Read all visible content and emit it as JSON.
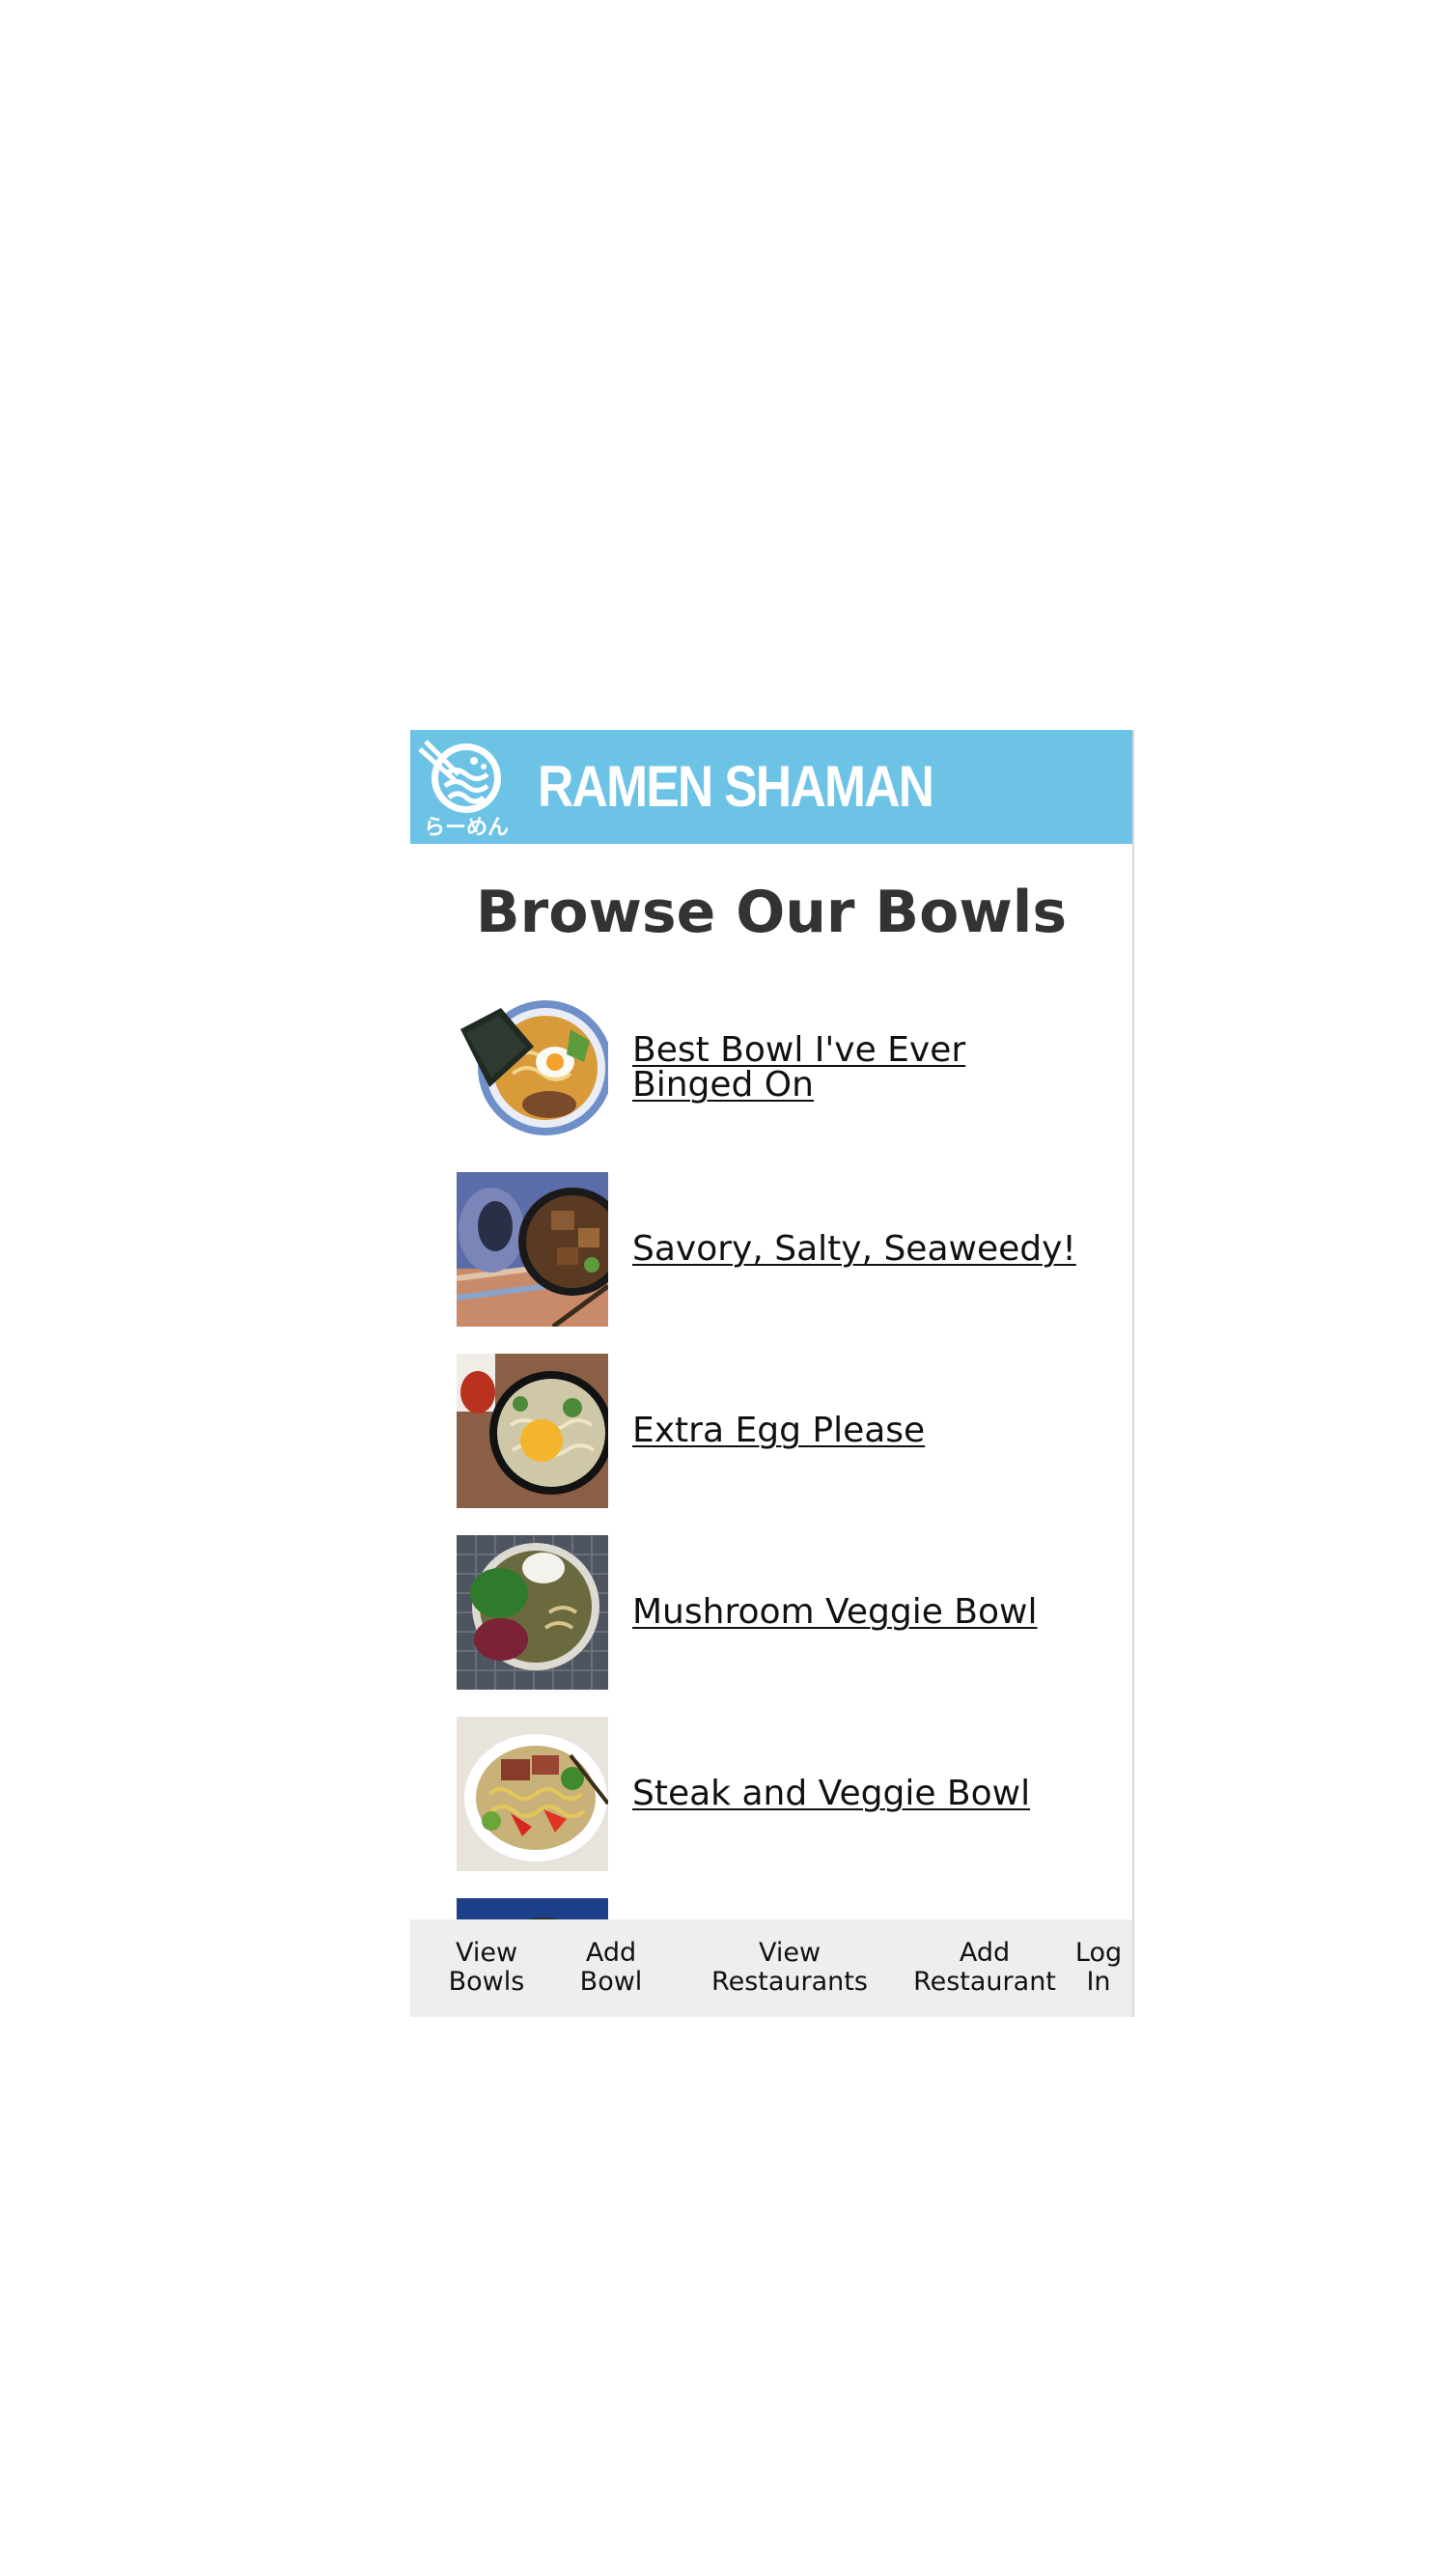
{
  "header": {
    "brand": "RAMEN SHAMAN",
    "logo_text": "らーめん",
    "logo_icon": "ramen-bowl-icon",
    "background": "#6cc3e6"
  },
  "main": {
    "title": "Browse Our Bowls",
    "bowls": [
      {
        "name": "Best Bowl I've Ever Binged On"
      },
      {
        "name": "Savory, Salty, Seaweedy!"
      },
      {
        "name": "Extra Egg Please"
      },
      {
        "name": "Mushroom Veggie Bowl"
      },
      {
        "name": "Steak and Veggie Bowl"
      }
    ]
  },
  "nav": {
    "items": [
      {
        "label": "View\nBowls"
      },
      {
        "label": "Add\nBowl"
      },
      {
        "label": "View\nRestaurants"
      },
      {
        "label": "Add\nRestaurant"
      },
      {
        "label": "Log\nIn"
      }
    ],
    "background": "#eeeeee"
  }
}
